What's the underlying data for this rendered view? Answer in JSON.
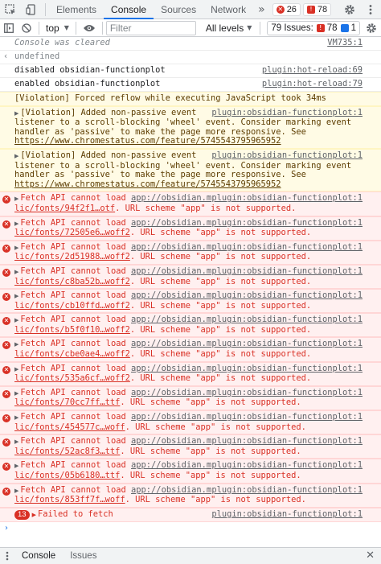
{
  "tabbar": {
    "tabs": [
      "Elements",
      "Console",
      "Sources",
      "Network"
    ],
    "more": "»",
    "error_count": "26",
    "warning_count": "78"
  },
  "filterbar": {
    "context": "top",
    "filter_placeholder": "Filter",
    "levels": "All levels",
    "issues_label": "79 Issues:",
    "issues_warn": "78",
    "issues_info": "1"
  },
  "console": {
    "cleared": {
      "text": "Console was cleared",
      "src": "VM735:1"
    },
    "undefined": "undefined",
    "info": [
      {
        "text": "disabled obsidian-functionplot",
        "src": "plugin:hot-reload:69"
      },
      {
        "text": "enabled obsidian-functionplot",
        "src": "plugin:hot-reload:79"
      }
    ],
    "reflow": "[Violation] Forced reflow while executing JavaScript took 34ms",
    "violations": [
      {
        "head": "[Violation] Added non-passive event",
        "src": "plugin:obsidian-functionplot:1",
        "body": "listener to a scroll-blocking 'wheel' event. Consider marking event handler as 'passive' to make the page more responsive. See ",
        "link": "https://www.chromestatus.com/feature/5745543795965952"
      },
      {
        "head": "[Violation] Added non-passive event",
        "src": "plugin:obsidian-functionplot:1",
        "body": "listener to a scroll-blocking 'wheel' event. Consider marking event handler as 'passive' to make the page more responsive. See ",
        "link": "https://www.chromestatus.com/feature/5745543795965952"
      }
    ],
    "fetch_prefix": "Fetch API cannot load",
    "fetch_url_start": "app://obsidian.md/pub",
    "fetch_suffix": ". URL scheme \"app\" is not supported.",
    "fetch_src": "plugin:obsidian-functionplot:1",
    "fetch_files": [
      "lic/fonts/94f2f1…otf",
      "lic/fonts/72505e6…woff2",
      "lic/fonts/2d51988…woff2",
      "lic/fonts/c8ba52b…woff2",
      "lic/fonts/cb10ffd…woff2",
      "lic/fonts/b5f0f10…woff2",
      "lic/fonts/cbe0ae4…woff2",
      "lic/fonts/535a6cf…woff2",
      "lic/fonts/70cc7ff…ttf",
      "lic/fonts/454577c…woff",
      "lic/fonts/52ac8f3…ttf",
      "lic/fonts/05b6180…ttf",
      "lic/fonts/853ff7f…woff"
    ],
    "group": {
      "count": "13",
      "text": "Failed to fetch",
      "src": "plugin:obsidian-functionplot:1"
    },
    "prompt": "›"
  },
  "drawer": {
    "tabs": [
      "Console",
      "Issues"
    ]
  },
  "colors": {
    "error": "#d93025",
    "accent": "#1a73e8",
    "warning_bg": "#fffbe5",
    "error_bg": "#fff0f0"
  }
}
